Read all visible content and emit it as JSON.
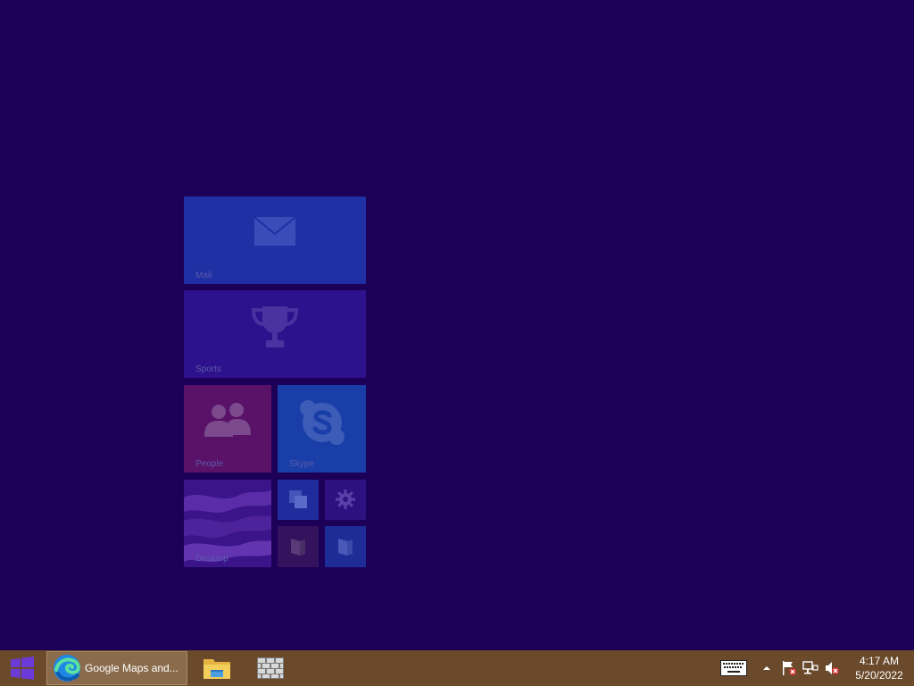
{
  "start_screen": {
    "tiles": {
      "mail": {
        "label": "Mail"
      },
      "sports": {
        "label": "Sports"
      },
      "people": {
        "label": "People"
      },
      "skype": {
        "label": "Skype"
      },
      "desktop": {
        "label": "Desktop"
      }
    }
  },
  "taskbar": {
    "running_apps": [
      {
        "label": "Google Maps and...",
        "icon": "edge-icon"
      }
    ],
    "pinned": [
      {
        "icon": "file-explorer-icon"
      },
      {
        "icon": "firewall-icon"
      }
    ]
  },
  "tray": {
    "icons": [
      "touch-keyboard-icon",
      "show-hidden-icons-icon",
      "action-center-flag-icon",
      "network-icon",
      "volume-muted-icon"
    ],
    "time": "4:17 AM",
    "date": "5/20/2022"
  },
  "colors": {
    "desktop_background": "#1c0058",
    "taskbar": "#6b4a2c",
    "active_app": "#8a6c4c"
  }
}
